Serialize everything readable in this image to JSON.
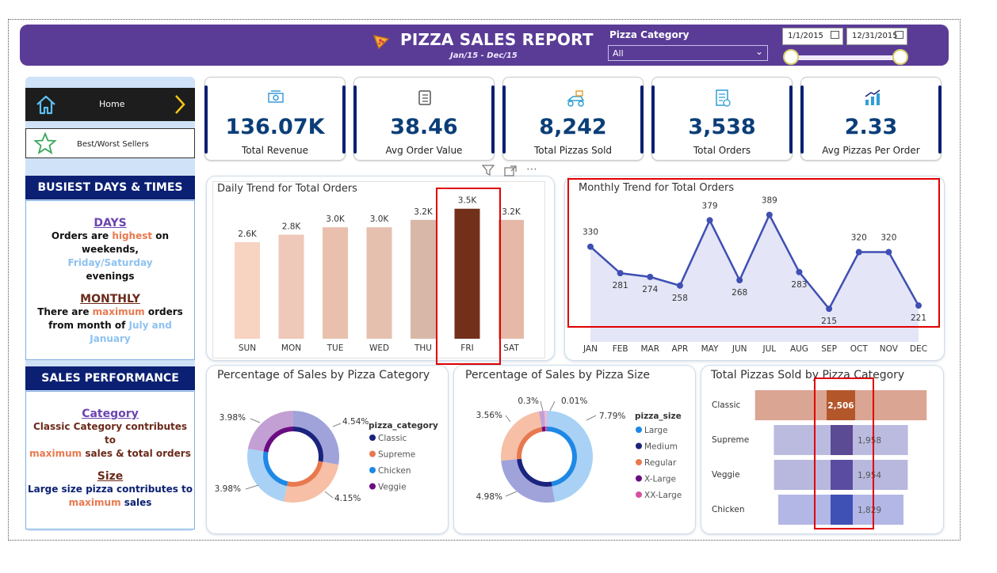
{
  "header": {
    "title": "PIZZA SALES REPORT",
    "subtitle": "Jan/15  -  Dec/15"
  },
  "filters": {
    "category_label": "Pizza Category",
    "category_value": "All",
    "date_start": "1/1/2015",
    "date_end": "12/31/2015"
  },
  "nav": {
    "home": "Home",
    "best_worst": "Best/Worst Sellers"
  },
  "busiest": {
    "title": "BUSIEST DAYS & TIMES",
    "days_heading": "DAYS",
    "days_l1a": "Orders are ",
    "days_l1b": "highest",
    "days_l1c": " on weekends,",
    "days_l2": "Friday/Saturday",
    "days_l3": "evenings",
    "monthly_heading": "MONTHLY",
    "monthly_l1a": "There are ",
    "monthly_l1b": "maximum",
    "monthly_l1c": " orders",
    "monthly_l2a": "from month of ",
    "monthly_l2b": "July and",
    "monthly_l3": "January"
  },
  "sales_perf": {
    "title": "SALES PERFORMANCE",
    "category_heading": "Category",
    "cat_l1": "Classic Category contributes to",
    "cat_l2a": "maximum",
    "cat_l2b": " sales & total orders",
    "size_heading": "Size",
    "size_l1": "Large size pizza contributes to",
    "size_l2": "maximum",
    "size_l2b": " sales"
  },
  "kpis": [
    {
      "value": "136.07K",
      "label": "Total Revenue",
      "icon": "money-icon"
    },
    {
      "value": "38.46",
      "label": "Avg Order Value",
      "icon": "clipboard-icon"
    },
    {
      "value": "8,242",
      "label": "Total Pizzas Sold",
      "icon": "delivery-icon"
    },
    {
      "value": "3,538",
      "label": "Total Orders",
      "icon": "order-list-icon"
    },
    {
      "value": "2.33",
      "label": "Avg Pizzas Per Order",
      "icon": "growth-chart-icon"
    }
  ],
  "colors": {
    "header": "#5a3c96",
    "navy": "#0b2073",
    "accent_orange": "#e8794f",
    "accent_blue": "#8ec2f0",
    "highlight_box": "#e00000"
  },
  "chart_data": [
    {
      "type": "bar",
      "title": "Daily Trend for Total Orders",
      "categories": [
        "SUN",
        "MON",
        "TUE",
        "WED",
        "THU",
        "FRI",
        "SAT"
      ],
      "values": [
        2.6,
        2.8,
        3.0,
        3.0,
        3.2,
        3.5,
        3.2
      ],
      "labels": [
        "2.6K",
        "2.8K",
        "3.0K",
        "3.0K",
        "3.2K",
        "3.5K",
        "3.2K"
      ],
      "colors": [
        "#f7d3c2",
        "#eec8b8",
        "#e8c0ad",
        "#e5c0ae",
        "#d9b7a8",
        "#72301b",
        "#e6b8a8"
      ],
      "ylim": [
        0,
        4.2
      ]
    },
    {
      "type": "area",
      "title": "Monthly Trend for Total Orders",
      "categories": [
        "JAN",
        "FEB",
        "MAR",
        "APR",
        "MAY",
        "JUN",
        "JUL",
        "AUG",
        "SEP",
        "OCT",
        "NOV",
        "DEC"
      ],
      "values": [
        330,
        281,
        274,
        258,
        379,
        268,
        389,
        283,
        215,
        320,
        320,
        221
      ],
      "ylim": [
        180,
        400
      ]
    },
    {
      "type": "pie",
      "title": "Percentage of Sales by Pizza Category",
      "legend_title": "pizza_category",
      "legend_placement": "right",
      "series": [
        {
          "name": "Classic",
          "color": "#1a237e"
        },
        {
          "name": "Supreme",
          "color": "#e8794f"
        },
        {
          "name": "Chicken",
          "color": "#1e88e5"
        },
        {
          "name": "Veggie",
          "color": "#6a0d83"
        }
      ],
      "slice_labels": [
        "4.54%",
        "4.15%",
        "3.98%",
        "3.98%"
      ]
    },
    {
      "type": "pie",
      "title": "Percentage of Sales by Pizza Size",
      "legend_title": "pizza_size",
      "legend_placement": "right",
      "series": [
        {
          "name": "Large",
          "color": "#1e88e5"
        },
        {
          "name": "Medium",
          "color": "#1a237e"
        },
        {
          "name": "Regular",
          "color": "#e8794f"
        },
        {
          "name": "X-Large",
          "color": "#6a0d83"
        },
        {
          "name": "XX-Large",
          "color": "#d64fa3"
        }
      ],
      "slice_labels": [
        "7.79%",
        "4.98%",
        "3.56%",
        "0.3%",
        "0.01%"
      ]
    },
    {
      "type": "bar",
      "title": "Total Pizzas Sold by Pizza Category",
      "categories": [
        "Classic",
        "Supreme",
        "Veggie",
        "Chicken"
      ],
      "values": [
        2506,
        1958,
        1954,
        1829
      ],
      "labels": [
        "2,506",
        "1,958",
        "1,954",
        "1,829"
      ],
      "xlim": [
        0,
        2600
      ]
    }
  ]
}
